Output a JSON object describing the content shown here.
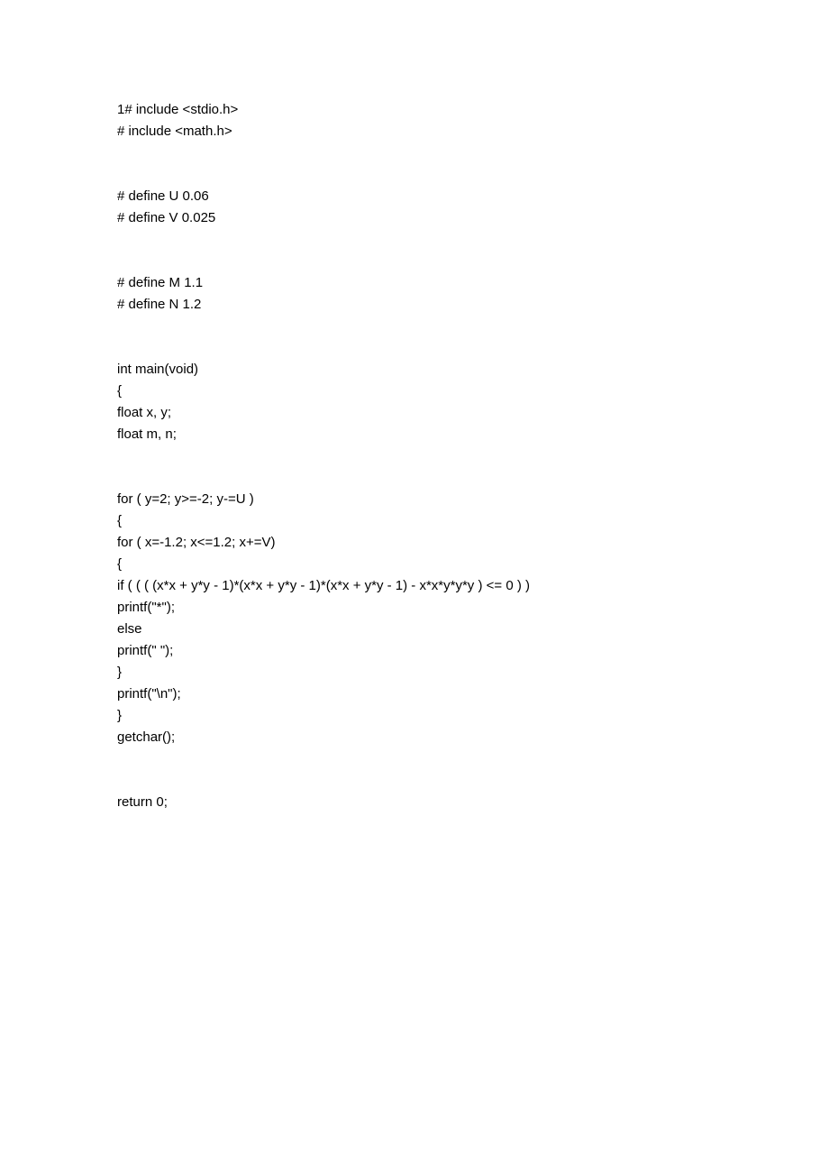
{
  "code": {
    "lines": [
      "1# include <stdio.h>",
      "# include <math.h>",
      "",
      "",
      "# define U 0.06",
      "# define V 0.025",
      "",
      "",
      "# define M 1.1",
      "# define N 1.2",
      "",
      "",
      "int main(void)",
      "{",
      "float x, y;",
      "float m, n;",
      "",
      "",
      "for ( y=2; y>=-2; y-=U )",
      "{",
      "for ( x=-1.2; x<=1.2; x+=V)",
      "{",
      "if ( ( ( (x*x + y*y - 1)*(x*x + y*y - 1)*(x*x + y*y - 1) - x*x*y*y*y ) <= 0 ) )",
      "printf(\"*\");",
      "else",
      "printf(\" \");",
      "}",
      "printf(\"\\n\");",
      "}",
      "getchar();",
      "",
      "",
      "return 0;"
    ]
  }
}
